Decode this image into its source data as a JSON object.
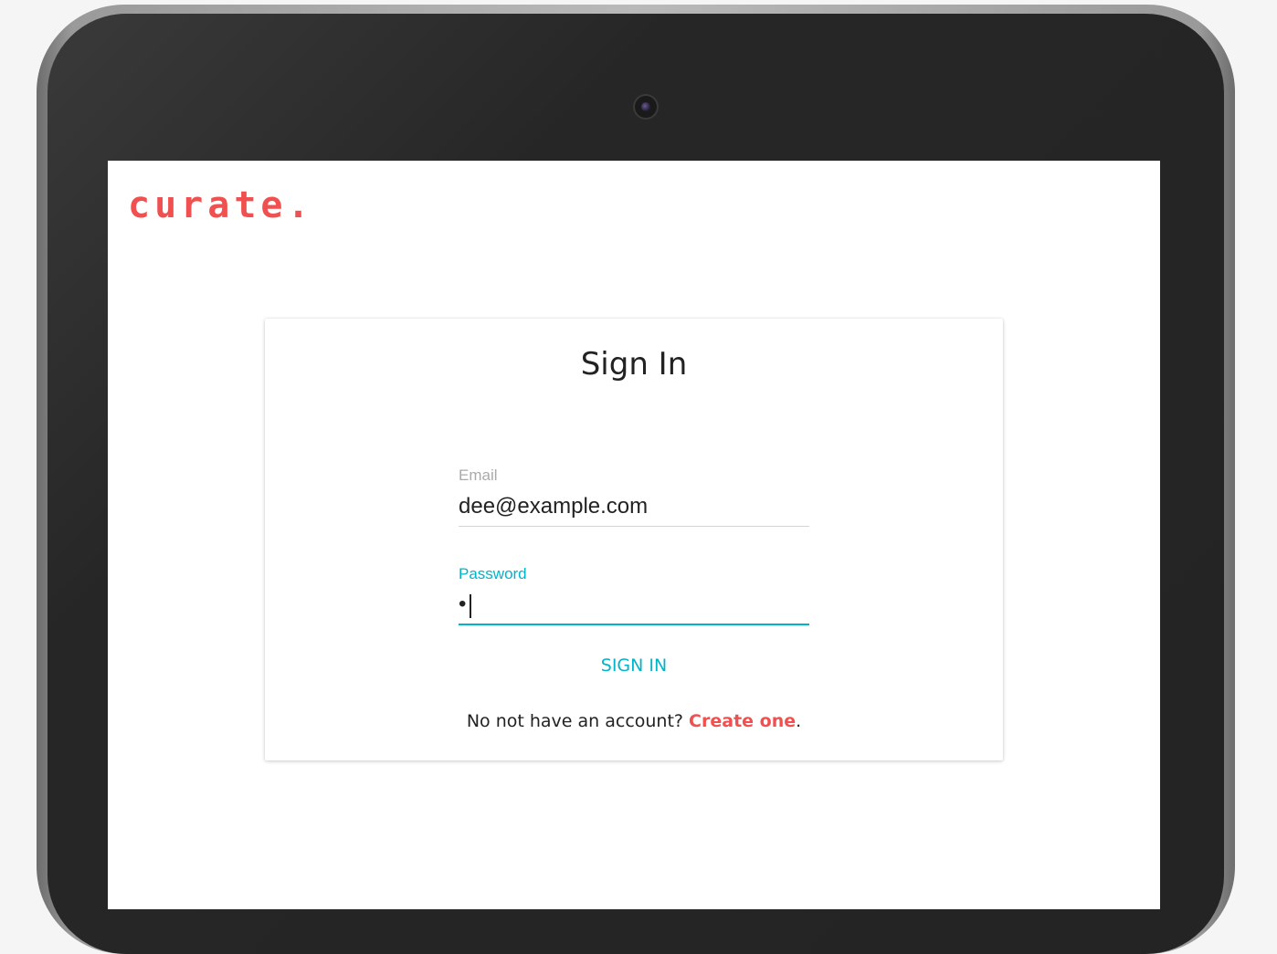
{
  "brand": {
    "logo_text": "curate.",
    "accent_color": "#f0504f",
    "focus_color": "#00b4c9"
  },
  "signin_card": {
    "title": "Sign In",
    "email": {
      "label": "Email",
      "value": "dee@example.com"
    },
    "password": {
      "label": "Password",
      "value": "•"
    },
    "submit_label": "SIGN IN",
    "account_prompt": "No not have an account?",
    "create_link": "Create one",
    "trailing_period": "."
  }
}
